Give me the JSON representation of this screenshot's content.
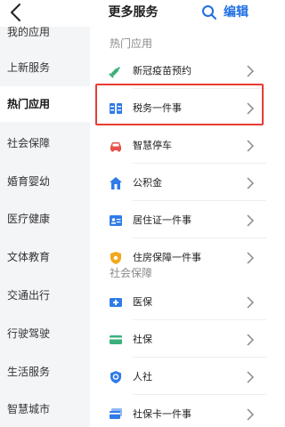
{
  "header": {
    "title": "更多服务",
    "edit_label": "编辑"
  },
  "sidebar": {
    "items": [
      {
        "label": "我的应用"
      },
      {
        "label": "上新服务"
      },
      {
        "label": "热门应用"
      },
      {
        "label": "社会保障"
      },
      {
        "label": "婚育婴幼"
      },
      {
        "label": "医疗健康"
      },
      {
        "label": "文体教育"
      },
      {
        "label": "交通出行"
      },
      {
        "label": "行驶驾驶"
      },
      {
        "label": "生活服务"
      },
      {
        "label": "智慧城市"
      }
    ],
    "active_index": 2
  },
  "sections": [
    {
      "title": "热门应用",
      "items": [
        {
          "label": "新冠疫苗预约",
          "icon": "syringe-icon",
          "color": "#3ab07a"
        },
        {
          "label": "税务一件事",
          "icon": "tax-icon",
          "color": "#2f7be8"
        },
        {
          "label": "智慧停车",
          "icon": "car-icon",
          "color": "#e8504a"
        },
        {
          "label": "公积金",
          "icon": "house-icon",
          "color": "#2f7be8"
        },
        {
          "label": "居住证一件事",
          "icon": "id-card-icon",
          "color": "#2f7be8"
        },
        {
          "label": "住房保障一件事",
          "icon": "shield-icon",
          "color": "#f2a81d"
        }
      ]
    },
    {
      "title": "社会保障",
      "items": [
        {
          "label": "医保",
          "icon": "medical-card-icon",
          "color": "#2f7be8"
        },
        {
          "label": "社保",
          "icon": "card-icon",
          "color": "#3ab07a"
        },
        {
          "label": "人社",
          "icon": "badge-icon",
          "color": "#2f7be8"
        },
        {
          "label": "社保卡一件事",
          "icon": "card-stack-icon",
          "color": "#2f7be8"
        }
      ]
    }
  ],
  "colors": {
    "accent": "#1f6fe3",
    "highlight": "#e83b35"
  }
}
